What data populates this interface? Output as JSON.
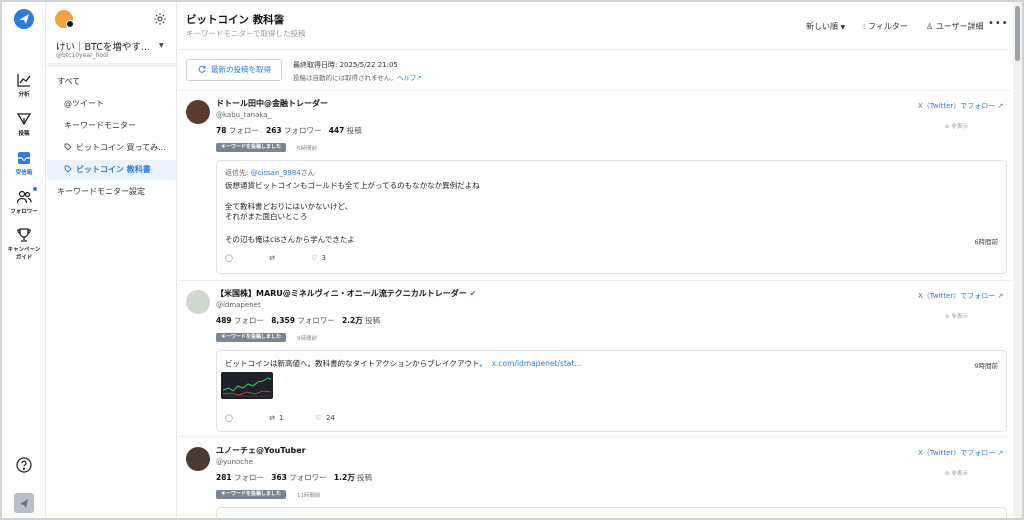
{
  "rail": {
    "items": [
      {
        "label": "分析",
        "icon": "chart-line-icon"
      },
      {
        "label": "投稿",
        "icon": "send-icon"
      },
      {
        "label": "受信箱",
        "icon": "inbox-icon"
      },
      {
        "label": "フォロワー",
        "icon": "users-icon"
      },
      {
        "label": "キャンペーン\nガイド",
        "label_line1": "キャンペーン",
        "label_line2": "ガイド",
        "icon": "trophy-icon"
      }
    ],
    "active": "受信箱"
  },
  "account": {
    "name": "けい｜BTCを増やす...",
    "handle": "@btc10year_hodl"
  },
  "sidebar": {
    "items": [
      {
        "label": "すべて",
        "level": 1
      },
      {
        "label": "@ツイート",
        "level": 2
      },
      {
        "label": "キーワードモニター",
        "level": 2
      },
      {
        "label": "ビットコイン 買ってみ...",
        "level": 3
      },
      {
        "label": "ビットコイン 教科書",
        "level": 3,
        "active": true
      },
      {
        "label": "キーワードモニター設定",
        "level": 1
      }
    ]
  },
  "header": {
    "title": "ビットコイン 教科書",
    "subtitle": "キーワードモニターで取得した投稿",
    "sort_label": "新しい順",
    "filter_label": "フィルター",
    "user_detail_label": "ユーザー詳細",
    "more_label": "•••"
  },
  "fetch": {
    "button_label": "最新の投稿を取得",
    "last_fetch": "最終取得日時: 2025/5/22 21:05",
    "note": "投稿は自動的には取得されません。",
    "help_label": "ヘルプ"
  },
  "posts": [
    {
      "name": "ドトール田中@金融トレーダー",
      "handle": "@kabu_tanaka_",
      "following": "78",
      "following_label": "フォロー",
      "followers": "263",
      "followers_label": "フォロワー",
      "posts": "447",
      "posts_label": "投稿",
      "follow_link": "X（Twitter）でフォロー",
      "hide_label": "非表示",
      "badge": "キーワードを投稿しました",
      "time": "6時間前",
      "reply_to_label": "返信先: ",
      "reply_to": "@cissan_9984",
      "reply_suffix": "さん",
      "body": [
        "仮想通貨ビットコインもゴールドも全て上がってるのもなかなか異例だよね",
        "",
        "全て教科書どおりにはいかないけど、",
        "それがまた面白いところ",
        "",
        "その辺も俺はcisさんから学んできたよ"
      ],
      "card_time": "6時間前",
      "retweets": "",
      "likes": "3"
    },
    {
      "name": "【米国株】MARU@ミネルヴィニ・オニール流テクニカルトレーダー",
      "handle": "@idmapenet",
      "following": "489",
      "following_label": "フォロー",
      "followers": "8,359",
      "followers_label": "フォロワー",
      "posts": "2.2万",
      "posts_label": "投稿",
      "follow_link": "X（Twitter）でフォロー",
      "hide_label": "非表示",
      "badge": "キーワードを投稿しました",
      "time": "9時間前",
      "body_text": "ビットコインは新高値へ。教科書的なタイトアクションからブレイクアウト。",
      "body_link": "x.com/idmapenet/stat...",
      "card_time": "9時間前",
      "retweets": "1",
      "likes": "24"
    },
    {
      "name": "ユノーチェ@YouTuber",
      "handle": "@yunoche",
      "following": "281",
      "following_label": "フォロー",
      "followers": "363",
      "followers_label": "フォロワー",
      "posts": "1.2万",
      "posts_label": "投稿",
      "follow_link": "X（Twitter）でフォロー",
      "hide_label": "非表示",
      "badge": "キーワードを投稿しました",
      "time": "11時間前"
    }
  ],
  "colors": {
    "accent": "#2c7be5",
    "badge": "#7a8591",
    "border": "#dfe2e6"
  }
}
